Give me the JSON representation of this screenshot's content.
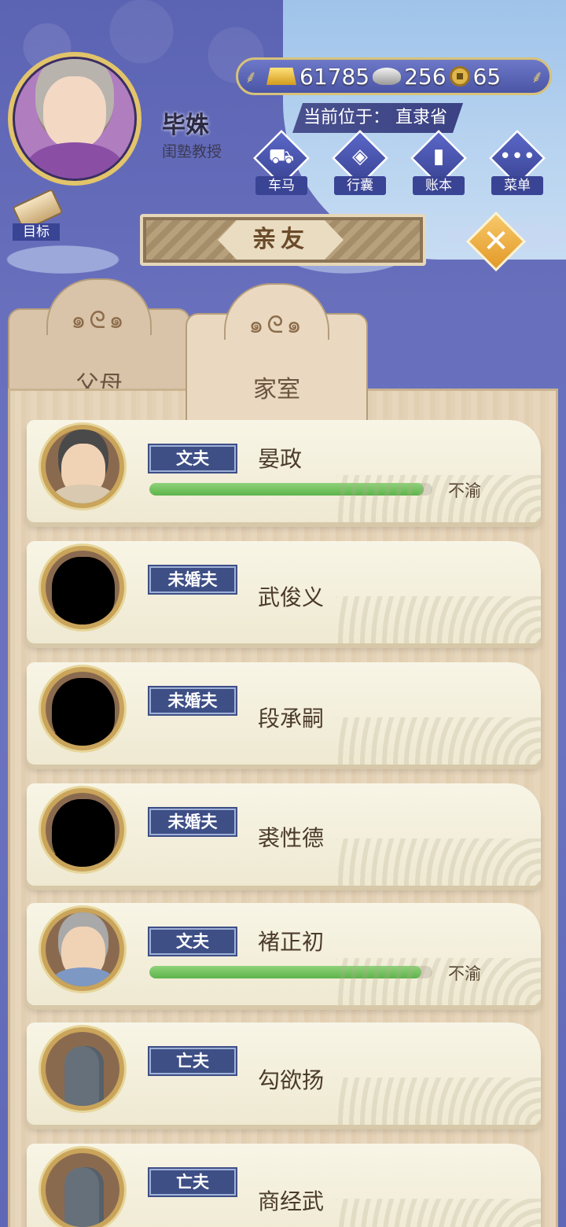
{
  "player": {
    "name": "毕姝",
    "title": "闺塾教授"
  },
  "resources": {
    "gold": "61785",
    "silver": "256",
    "coins": "65"
  },
  "location": {
    "label": "当前位于：",
    "value": "直隶省"
  },
  "actions": [
    {
      "label": "车马",
      "icon": "carriage-icon"
    },
    {
      "label": "行囊",
      "icon": "bag-icon"
    },
    {
      "label": "账本",
      "icon": "ledger-icon"
    },
    {
      "label": "菜单",
      "icon": "menu-icon"
    }
  ],
  "goal": {
    "label": "目标"
  },
  "header": {
    "title": "亲友"
  },
  "tabs": [
    {
      "label": "父母",
      "active": false
    },
    {
      "label": "家室",
      "active": true
    }
  ],
  "entries": [
    {
      "relation": "文夫",
      "name": "晏政",
      "mood": "不渝",
      "affection_fraction": 0.97,
      "portrait": "husband-portrait"
    },
    {
      "relation": "未婚夫",
      "name": "武俊义",
      "mood": "",
      "affection_fraction": null,
      "portrait": "silhouette"
    },
    {
      "relation": "未婚夫",
      "name": "段承嗣",
      "mood": "",
      "affection_fraction": null,
      "portrait": "silhouette"
    },
    {
      "relation": "未婚夫",
      "name": "裘性德",
      "mood": "",
      "affection_fraction": null,
      "portrait": "silhouette"
    },
    {
      "relation": "文夫",
      "name": "褚正初",
      "mood": "不渝",
      "affection_fraction": 0.96,
      "portrait": "husband-portrait-elder"
    },
    {
      "relation": "亡夫",
      "name": "勾欲扬",
      "mood": "",
      "affection_fraction": null,
      "portrait": "tombstone"
    },
    {
      "relation": "亡夫",
      "name": "商经武",
      "mood": "",
      "affection_fraction": null,
      "portrait": "tombstone"
    }
  ],
  "colors": {
    "accent_blue": "#3e4f86",
    "affection_green": "#5db34b",
    "close_orange": "#e39a28"
  }
}
